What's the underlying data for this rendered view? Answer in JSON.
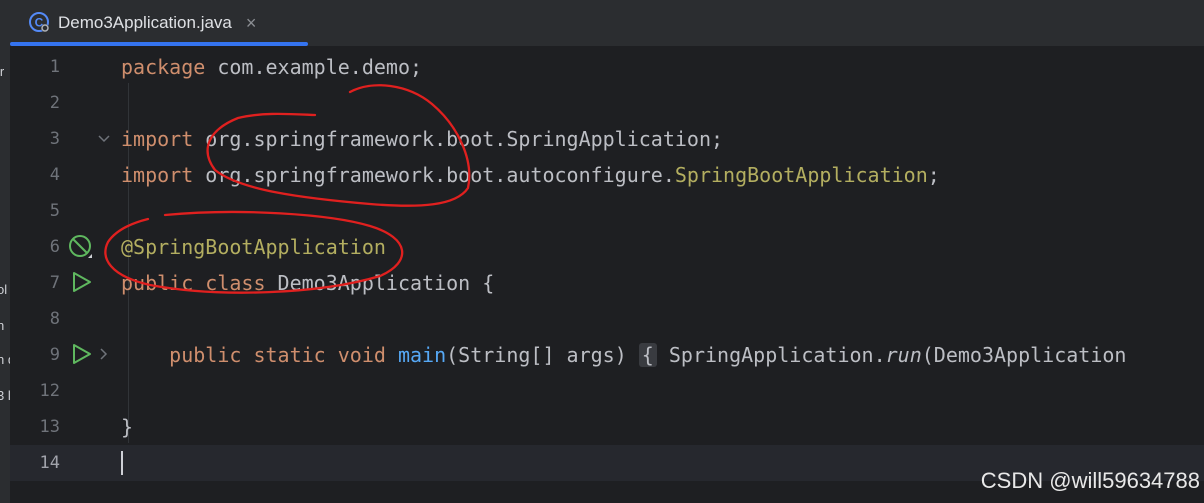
{
  "tab": {
    "label": "Demo3Application.java",
    "close": "×"
  },
  "side_fragments": [
    "ir",
    "ol",
    "n",
    "n d",
    "3 l"
  ],
  "lines": [
    {
      "n": "1"
    },
    {
      "n": "2"
    },
    {
      "n": "3"
    },
    {
      "n": "4"
    },
    {
      "n": "5"
    },
    {
      "n": "6"
    },
    {
      "n": "7"
    },
    {
      "n": "8"
    },
    {
      "n": "9"
    },
    {
      "n": "12"
    },
    {
      "n": "13"
    },
    {
      "n": "14"
    }
  ],
  "code": {
    "l1": {
      "kw": "package",
      "rest": " com.example.demo;"
    },
    "l3": {
      "kw": "import",
      "rest": " org.springframework.boot.SpringApplication;"
    },
    "l4": {
      "kw": "import",
      "pkg": " org.springframework.boot.autoconfigure.",
      "cls": "SpringBootApplication",
      "semi": ";"
    },
    "l6": {
      "ann": "@SpringBootApplication"
    },
    "l7": {
      "kw": "public class",
      "rest": " Demo3Application {"
    },
    "l9": {
      "indent": "    ",
      "kw": "public static void",
      "sp": " ",
      "fn": "main",
      "params": "(String[] args) ",
      "brace": "{",
      "body1": " SpringApplication.",
      "run": "run",
      "body2": "(Demo3Application"
    },
    "l13": {
      "text": "}"
    }
  },
  "icons": {
    "l6": "spring-bean-icon",
    "l7": "run-icon",
    "l9": "run-icon"
  },
  "colors": {
    "keyword": "#cf8e6d",
    "annotation": "#b3ae60",
    "function": "#56a8f5",
    "text": "#bcbec4",
    "annotation_marks": "#e02020"
  },
  "watermark": "CSDN @will59634788"
}
